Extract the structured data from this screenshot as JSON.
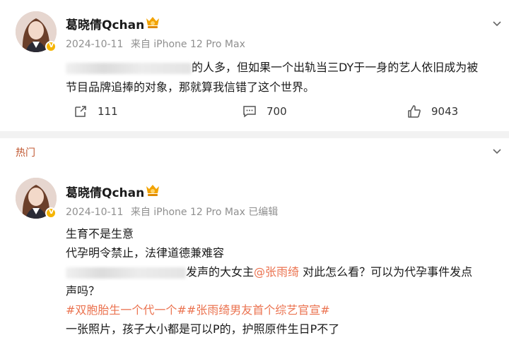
{
  "post1": {
    "username": "葛晓倩Qchan",
    "date": "2024-10-11",
    "source": "来自 iPhone 12 Pro Max",
    "line1_text": "的人多，但如果一个出轨当三DY于一身的艺人依旧成为被",
    "line2_text": "节目品牌追捧的对象，那就算我信错了这个世界。",
    "repost_count": "111",
    "comment_count": "700",
    "like_count": "9043"
  },
  "section_label": "热门",
  "post2": {
    "username": "葛晓倩Qchan",
    "date": "2024-10-11",
    "source": "来自 iPhone 12 Pro Max",
    "edited": "已编辑",
    "line1": "生育不是生意",
    "line2": "代孕明令禁止，法律道德兼难容",
    "line3_text": "发声的大女主",
    "mention": "@张雨绮",
    "line3_tail": " 对此怎么看？可以为代孕事件发点",
    "line4": "声吗？",
    "topic1": "#双胞胎生一个代一个#",
    "topic2": "#张雨绮男友首个综艺官宣#",
    "line6": "一张照片，孩子大小都是可以P的，护照原件生日P不了"
  },
  "colors": {
    "accent": "#eb7350",
    "section_label": "#c0562f",
    "meta_gray": "#8f8f8f",
    "divider": "#f2f2f2",
    "verify_gold": "#f5b400"
  },
  "icons": [
    "repost-icon",
    "comment-icon",
    "like-icon",
    "chevron-down-icon",
    "verified-icon",
    "vip-badge-icon"
  ]
}
